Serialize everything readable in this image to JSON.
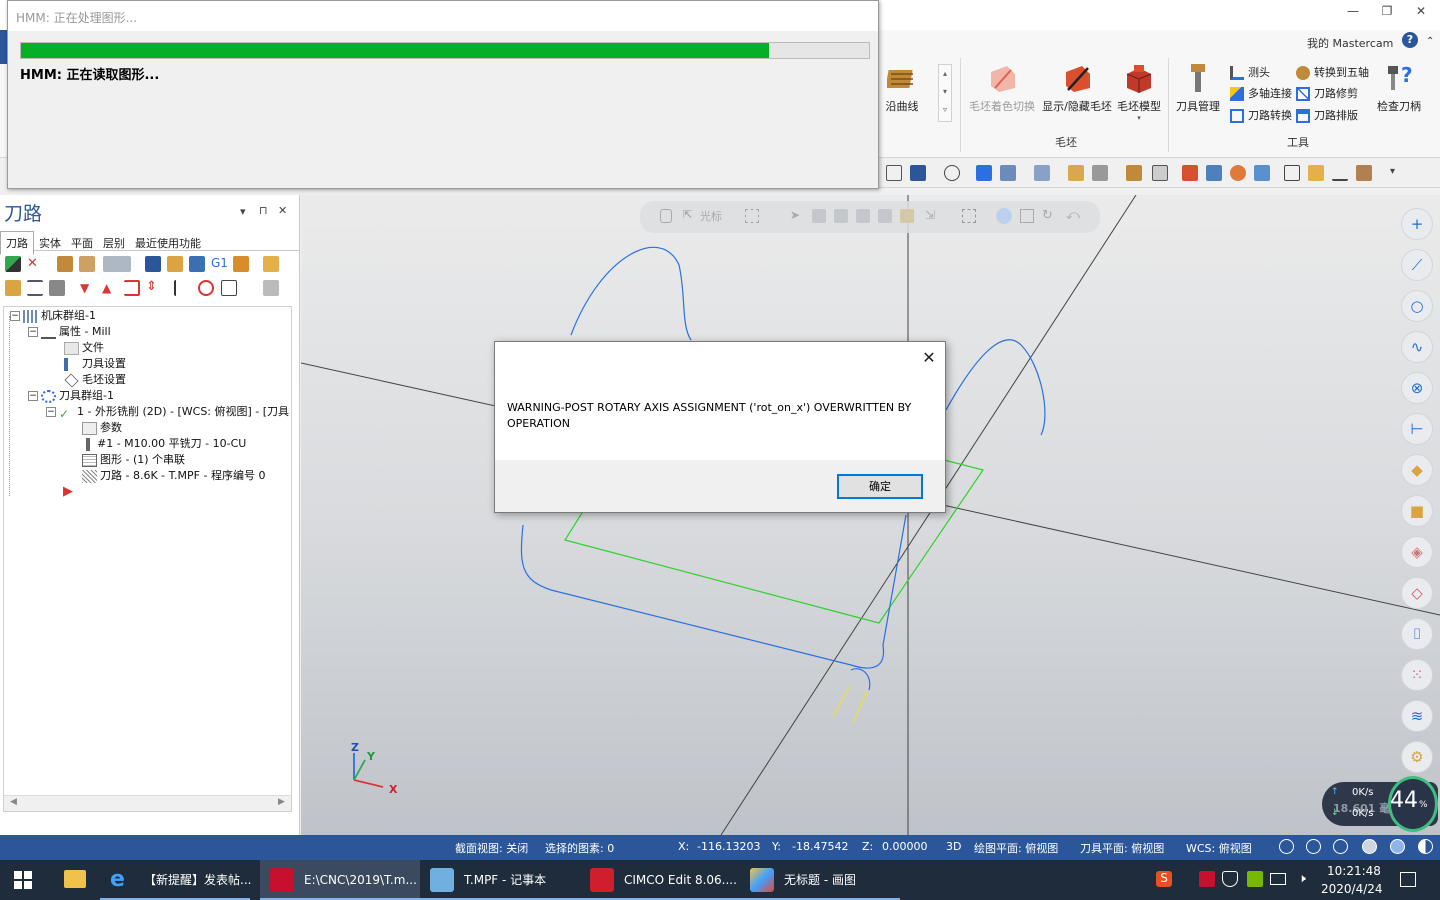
{
  "app": {
    "user_label": "我的 Mastercam",
    "help_glyph": "?",
    "window_controls": [
      "—",
      "❐",
      "✕"
    ]
  },
  "ribbon": {
    "partial_button": "沿曲线",
    "stock_group": {
      "label": "毛坯",
      "buttons": [
        "毛坯着色切换",
        "显示/隐藏毛坯",
        "毛坯模型"
      ]
    },
    "tools_group": {
      "label": "工具",
      "tool_manager": "刀具管理",
      "small": [
        "测头",
        "多轴连接",
        "刀路转换",
        "转换到五轴",
        "刀路修剪",
        "刀路排版"
      ],
      "check_holder": "检查刀柄"
    }
  },
  "hmm_dialog": {
    "title": "HMM: 正在处理图形...",
    "message": "HMM: 正在读取图形...",
    "progress": 0.882
  },
  "left_panel": {
    "title": "刀路",
    "controls": [
      "▾",
      "⊓",
      "✕"
    ],
    "tabs": [
      "刀路",
      "实体",
      "平面",
      "层别",
      "最近使用功能"
    ],
    "tree": [
      {
        "label": "机床群组-1",
        "level": 0
      },
      {
        "label": "属性 - Mill",
        "level": 1
      },
      {
        "label": "文件",
        "level": 2
      },
      {
        "label": "刀具设置",
        "level": 2
      },
      {
        "label": "毛坯设置",
        "level": 2
      },
      {
        "label": "刀具群组-1",
        "level": 1
      },
      {
        "label": "1 - 外形铣削 (2D) - [WCS: 俯视图] - [刀具",
        "level": 2
      },
      {
        "label": "参数",
        "level": 3
      },
      {
        "label": "#1 - M10.00 平铣刀 - 10-CU",
        "level": 3
      },
      {
        "label": "图形 - (1) 个串联",
        "level": 3
      },
      {
        "label": "刀路 - 8.6K - T.MPF - 程序编号 0",
        "level": 3
      }
    ],
    "toolbar_label_g1": "G1"
  },
  "viewport": {
    "toolbar_hint": "光标",
    "axes": {
      "x": "X",
      "y": "Y",
      "z": "Z"
    }
  },
  "warning_dialog": {
    "message": "WARNING-POST ROTARY AXIS ASSIGNMENT ('rot_on_x') OVERWRITTEN BY OPERATION",
    "ok_label": "确定",
    "close_glyph": "✕"
  },
  "status_bar": {
    "section_view": "截面视图: 关闭",
    "selected": "选择的图素: 0",
    "x_label": "X:",
    "x_value": "-116.13203",
    "y_label": "Y:",
    "y_value": "-18.47542",
    "z_label": "Z:",
    "z_value": "0.00000",
    "mode": "3D",
    "draw_plane": "绘图平面: 俯视图",
    "tool_plane": "刀具平面: 俯视图",
    "wcs": "WCS: 俯视图"
  },
  "net_meter": {
    "up": "0K/s",
    "down": "0K/s",
    "percent": "44",
    "percent_sign": "%",
    "behind_text": "18.601 毫米"
  },
  "taskbar": {
    "items": [
      {
        "label": "【新提醒】发表帖...",
        "icon": "ie-icon"
      },
      {
        "label": "E:\\CNC\\2019\\T.m...",
        "icon": "mastercam-icon"
      },
      {
        "label": "T.MPF - 记事本",
        "icon": "notepad-icon"
      },
      {
        "label": "CIMCO Edit 8.06....",
        "icon": "cimco-icon"
      },
      {
        "label": "无标题 - 画图",
        "icon": "paint-icon"
      }
    ],
    "time": "10:21:48",
    "date": "2020/4/24"
  },
  "colors": {
    "accent": "#2b579a",
    "progress": "#06b025",
    "taskbar": "#1f2c3c",
    "toolpath": "#2b6fe0",
    "stock": "#2fd22f",
    "axis_line": "#444444"
  }
}
